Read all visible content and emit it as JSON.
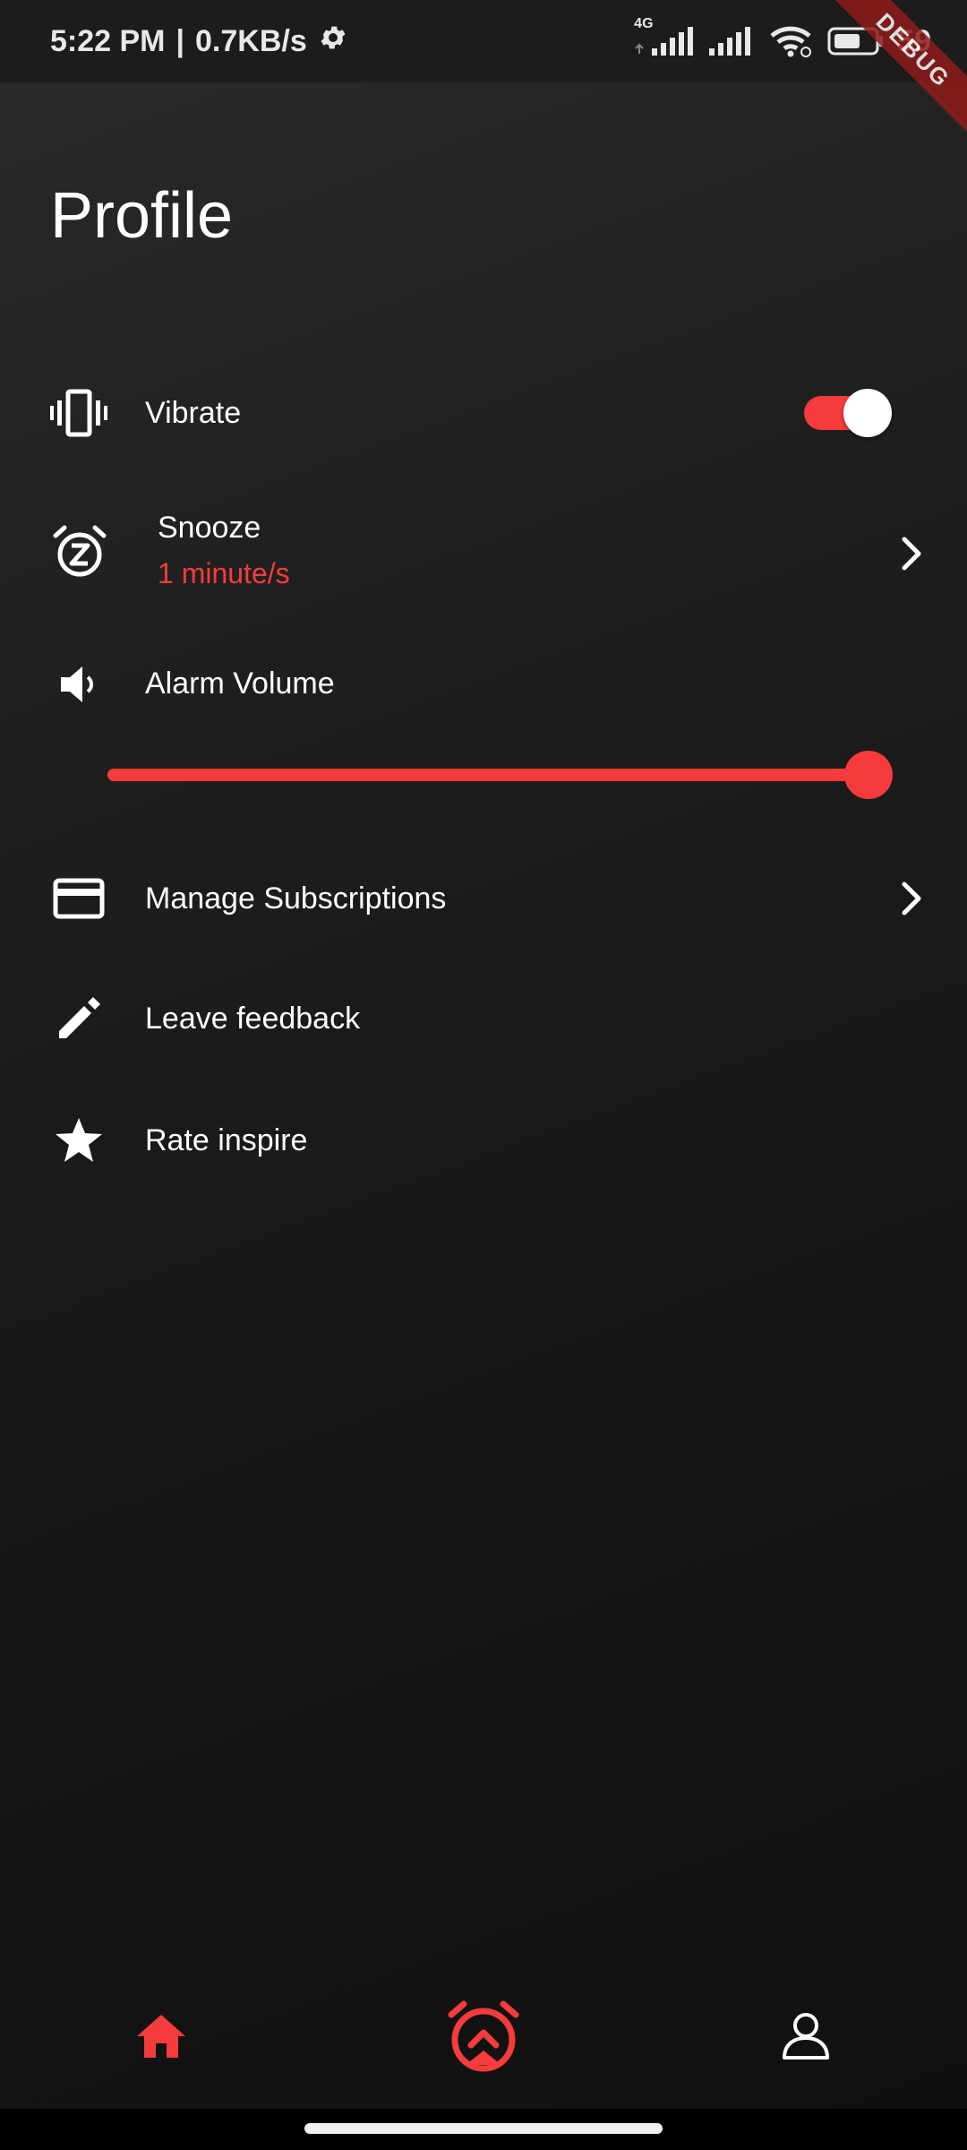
{
  "status_bar": {
    "time": "5:22 PM",
    "separator": "|",
    "speed": "0.7KB/s",
    "network_type": "4G",
    "battery_text": "59"
  },
  "debug_banner": "DEBUG",
  "page": {
    "title": "Profile"
  },
  "settings": {
    "vibrate": {
      "label": "Vibrate",
      "enabled": true
    },
    "snooze": {
      "label": "Snooze",
      "value": "1 minute/s"
    },
    "alarm_volume": {
      "label": "Alarm Volume",
      "level": 1.0
    },
    "subscriptions": {
      "label": "Manage Subscriptions"
    },
    "feedback": {
      "label": "Leave feedback"
    },
    "rate": {
      "label": "Rate inspire"
    }
  },
  "bottom_nav": {
    "items": [
      {
        "icon": "home-icon",
        "active": true
      },
      {
        "icon": "alarm-icon",
        "active": true
      },
      {
        "icon": "profile-icon",
        "active": false
      }
    ]
  },
  "colors": {
    "accent": "#f53b3b",
    "background": "#161616",
    "text": "#ffffff"
  }
}
